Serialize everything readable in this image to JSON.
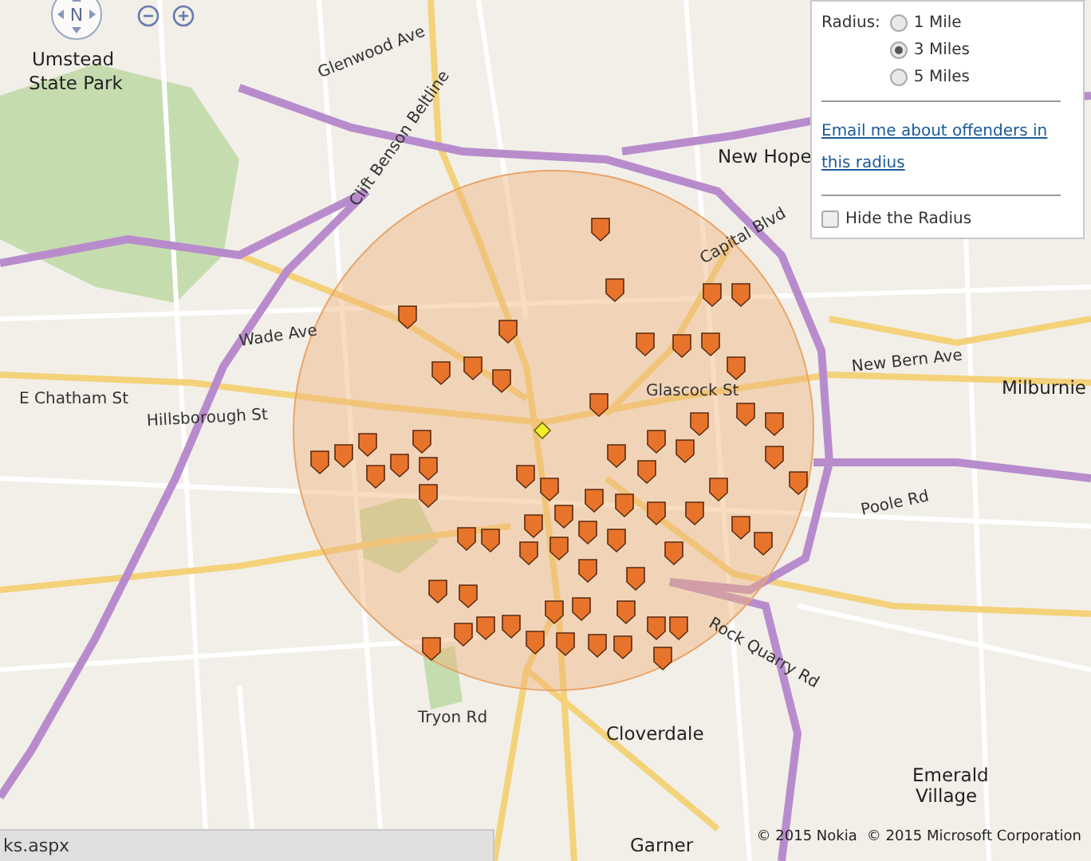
{
  "map": {
    "labels": [
      {
        "text": "Umstead",
        "kind": "place"
      },
      {
        "text": "State Park",
        "kind": "place"
      },
      {
        "text": "Glenwood Ave",
        "kind": "road"
      },
      {
        "text": "New Hope",
        "kind": "place"
      },
      {
        "text": "Wade Ave",
        "kind": "road"
      },
      {
        "text": "E Chatham St",
        "kind": "road"
      },
      {
        "text": "Hillsborough St",
        "kind": "road"
      },
      {
        "text": "Glascock St",
        "kind": "road"
      },
      {
        "text": "New Bern Ave",
        "kind": "road"
      },
      {
        "text": "Milburnie",
        "kind": "place"
      },
      {
        "text": "Capital Blvd",
        "kind": "road"
      },
      {
        "text": "Clift Benson Beltline",
        "kind": "road"
      },
      {
        "text": "Cloverdale",
        "kind": "place"
      },
      {
        "text": "Emerald",
        "kind": "place"
      },
      {
        "text": "Village",
        "kind": "place"
      },
      {
        "text": "Garner",
        "kind": "place"
      },
      {
        "text": "Tryon Rd",
        "kind": "road"
      },
      {
        "text": "Poole Rd",
        "kind": "road"
      },
      {
        "text": "Rock Quarry Rd",
        "kind": "road"
      }
    ]
  },
  "navigation": {
    "compass_label": "N"
  },
  "radius_panel": {
    "label": "Radius:",
    "options": [
      {
        "label": "1 Mile",
        "selected": false
      },
      {
        "label": "3 Miles",
        "selected": true
      },
      {
        "label": "5 Miles",
        "selected": false
      }
    ],
    "email_link": "Email me about offenders in this radius",
    "hide_radius": {
      "label": "Hide the Radius",
      "checked": false
    }
  },
  "attribution": [
    "© 2015 Nokia",
    "© 2015 Microsoft Corporation"
  ],
  "status_bar": {
    "url": "ks.aspx"
  }
}
